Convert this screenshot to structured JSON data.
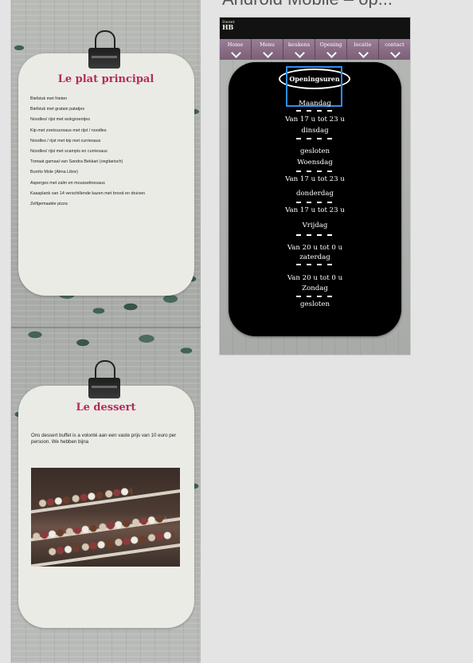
{
  "left_page": {
    "main_course": {
      "title": "Le plat principal",
      "items": [
        "Biefstuk met frieten",
        "Biefstuk met gratain patatjes",
        "Noodles/ rijst met wokgroentjes",
        "Kip met zoetzuursaus  met rijst / noodles",
        "Noodles / rijst met kip met curriesaus",
        "Noodles/ rijst met scampis en curriesaus",
        "Tomaat gamaal van Sandra Bekkari (vegitarisch)",
        "Burrito Mole (Alma Libre)",
        "Asperges met zalm en mousselinesaus",
        "Kaasplank van 14 verschillende kazen met brood en druiven",
        "Zelfgemaakte pizza"
      ]
    },
    "dessert": {
      "title": "Le dessert",
      "description": "Ons dessert buffet is a volonté aan een vaste prijs van 10 euro per persoon. We hebben bijna"
    }
  },
  "right_page": {
    "window_title": "Android Mobile – op...",
    "logo": {
      "line1": "Sweet",
      "line2": "HB"
    },
    "nav": [
      {
        "label": "Home"
      },
      {
        "label": "Menu"
      },
      {
        "label": "keukens"
      },
      {
        "label": "Opening"
      },
      {
        "label": "locatie"
      },
      {
        "label": "contact"
      }
    ],
    "hours": {
      "title": "Openingsuren",
      "lines": [
        "Maandag",
        "Van 17 u tot 23 u",
        "dinsdag",
        "gesloten",
        "Woensdag",
        "Van 17 u tot 23 u",
        "donderdag",
        "Van 17 u tot 23 u",
        "Vrijdag",
        "Van 20 u tot 0 u",
        "zaterdag",
        "Van 20 u tot 0 u",
        "Zondag",
        "gesloten"
      ]
    }
  },
  "colors": {
    "title_accent": "#b02d5b",
    "nav_purple": "#8a6e86",
    "selection_blue": "#2e8ef0"
  }
}
